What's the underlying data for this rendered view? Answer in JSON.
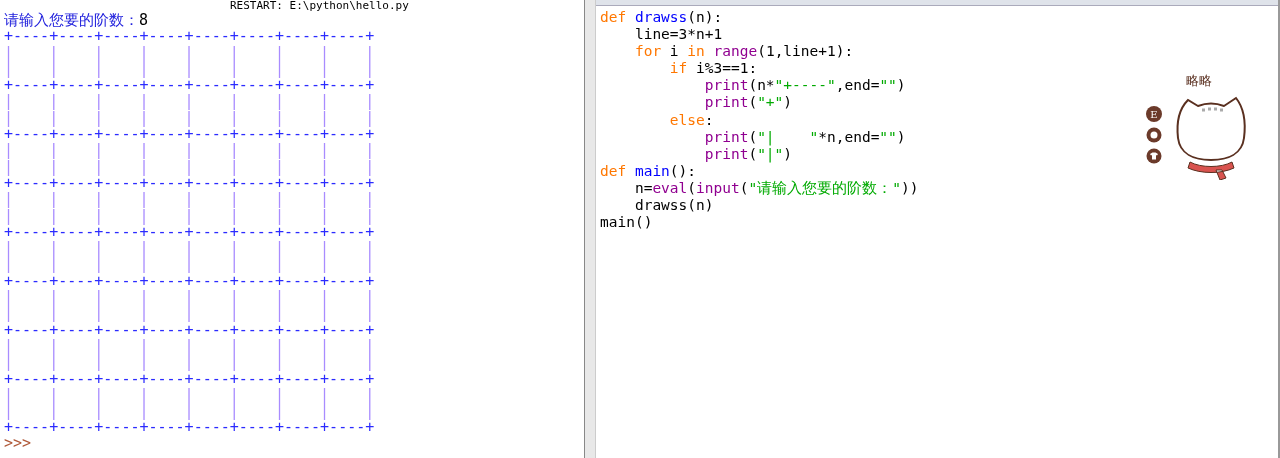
{
  "shell": {
    "restart_line": "RESTART: E:\\python\\hello.py",
    "prompt": "请输入您要的阶数：",
    "input": "8",
    "lines": [
      {
        "kind": "border",
        "text": "+----+----+----+----+----+----+----+----+"
      },
      {
        "kind": "bars",
        "text": "|    |    |    |    |    |    |    |    |"
      },
      {
        "kind": "bars",
        "text": "|    |    |    |    |    |    |    |    |"
      },
      {
        "kind": "border",
        "text": "+----+----+----+----+----+----+----+----+"
      },
      {
        "kind": "bars",
        "text": "|    |    |    |    |    |    |    |    |"
      },
      {
        "kind": "bars",
        "text": "|    |    |    |    |    |    |    |    |"
      },
      {
        "kind": "border",
        "text": "+----+----+----+----+----+----+----+----+"
      },
      {
        "kind": "bars",
        "text": "|    |    |    |    |    |    |    |    |"
      },
      {
        "kind": "bars",
        "text": "|    |    |    |    |    |    |    |    |"
      },
      {
        "kind": "border",
        "text": "+----+----+----+----+----+----+----+----+"
      },
      {
        "kind": "bars",
        "text": "|    |    |    |    |    |    |    |    |"
      },
      {
        "kind": "bars",
        "text": "|    |    |    |    |    |    |    |    |"
      },
      {
        "kind": "border",
        "text": "+----+----+----+----+----+----+----+----+"
      },
      {
        "kind": "bars",
        "text": "|    |    |    |    |    |    |    |    |"
      },
      {
        "kind": "bars",
        "text": "|    |    |    |    |    |    |    |    |"
      },
      {
        "kind": "border",
        "text": "+----+----+----+----+----+----+----+----+"
      },
      {
        "kind": "bars",
        "text": "|    |    |    |    |    |    |    |    |"
      },
      {
        "kind": "bars",
        "text": "|    |    |    |    |    |    |    |    |"
      },
      {
        "kind": "border",
        "text": "+----+----+----+----+----+----+----+----+"
      },
      {
        "kind": "bars",
        "text": "|    |    |    |    |    |    |    |    |"
      },
      {
        "kind": "bars",
        "text": "|    |    |    |    |    |    |    |    |"
      },
      {
        "kind": "border",
        "text": "+----+----+----+----+----+----+----+----+"
      },
      {
        "kind": "bars",
        "text": "|    |    |    |    |    |    |    |    |"
      },
      {
        "kind": "bars",
        "text": "|    |    |    |    |    |    |    |    |"
      },
      {
        "kind": "border",
        "text": "+----+----+----+----+----+----+----+----+"
      }
    ],
    "next_prompt": ">>>"
  },
  "editor": {
    "code": [
      [
        {
          "kind": "keyword",
          "text": "def"
        },
        {
          "kind": "definition",
          "text": " drawss"
        },
        {
          "kind": "plain",
          "text": "(n):"
        }
      ],
      [
        {
          "kind": "plain",
          "text": "    line=3*n+1"
        }
      ],
      [
        {
          "kind": "keyword",
          "text": "    for"
        },
        {
          "kind": "plain",
          "text": " i "
        },
        {
          "kind": "keyword",
          "text": "in"
        },
        {
          "kind": "builtin",
          "text": " range"
        },
        {
          "kind": "plain",
          "text": "(1,line+1):"
        }
      ],
      [
        {
          "kind": "keyword",
          "text": "        if"
        },
        {
          "kind": "plain",
          "text": " i%3==1:"
        }
      ],
      [
        {
          "kind": "builtin",
          "text": "            print"
        },
        {
          "kind": "plain",
          "text": "(n*"
        },
        {
          "kind": "string",
          "text": "\"+----\""
        },
        {
          "kind": "plain",
          "text": ",end="
        },
        {
          "kind": "string",
          "text": "\"\""
        },
        {
          "kind": "plain",
          "text": ")"
        }
      ],
      [
        {
          "kind": "builtin",
          "text": "            print"
        },
        {
          "kind": "plain",
          "text": "("
        },
        {
          "kind": "string",
          "text": "\"+\""
        },
        {
          "kind": "plain",
          "text": ")"
        }
      ],
      [
        {
          "kind": "keyword",
          "text": "        else"
        },
        {
          "kind": "plain",
          "text": ":"
        }
      ],
      [
        {
          "kind": "builtin",
          "text": "            print"
        },
        {
          "kind": "plain",
          "text": "("
        },
        {
          "kind": "string",
          "text": "\"|    \""
        },
        {
          "kind": "plain",
          "text": "*n,end="
        },
        {
          "kind": "string",
          "text": "\"\""
        },
        {
          "kind": "plain",
          "text": ")"
        }
      ],
      [
        {
          "kind": "builtin",
          "text": "            print"
        },
        {
          "kind": "plain",
          "text": "("
        },
        {
          "kind": "string",
          "text": "\"|\""
        },
        {
          "kind": "plain",
          "text": ")"
        }
      ],
      [
        {
          "kind": "keyword",
          "text": "def"
        },
        {
          "kind": "definition",
          "text": " main"
        },
        {
          "kind": "plain",
          "text": "():"
        }
      ],
      [
        {
          "kind": "plain",
          "text": "    n="
        },
        {
          "kind": "builtin",
          "text": "eval"
        },
        {
          "kind": "plain",
          "text": "("
        },
        {
          "kind": "builtin",
          "text": "input"
        },
        {
          "kind": "plain",
          "text": "("
        },
        {
          "kind": "string",
          "text": "\"请输入您要的阶数：\""
        },
        {
          "kind": "plain",
          "text": "))"
        }
      ],
      [
        {
          "kind": "plain",
          "text": "    drawss(n)"
        }
      ],
      [
        {
          "kind": "plain",
          "text": "main()"
        }
      ]
    ]
  },
  "sticker": {
    "caption": "略略",
    "badge": "E"
  }
}
